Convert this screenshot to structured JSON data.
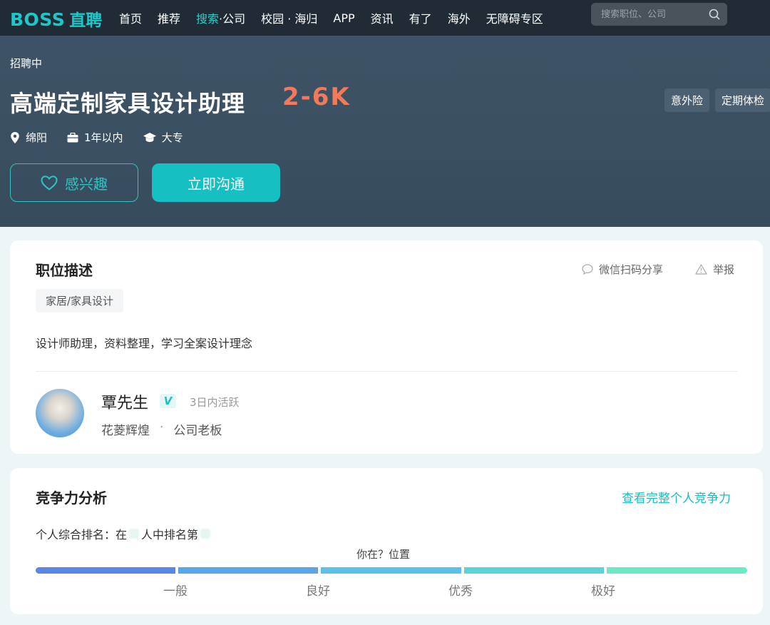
{
  "nav": {
    "logo_text": "BOSS",
    "logo_sub": "直聘",
    "items": [
      "首页",
      "推荐",
      "搜索",
      "·公司",
      "校园 · 海归",
      "APP",
      "资讯",
      "有了",
      "海外",
      "无障碍专区"
    ],
    "search_placeholder": "搜索职位、公司"
  },
  "job": {
    "status": "招聘中",
    "title": "高端定制家具设计助理",
    "salary": "2-6K",
    "location": "绵阳",
    "experience": "1年以内",
    "education": "大专",
    "benefits": [
      "意外险",
      "定期体检"
    ],
    "like_label": "感兴趣",
    "chat_label": "立即沟通"
  },
  "description": {
    "heading": "职位描述",
    "share_label": "微信扫码分享",
    "report_label": "举报",
    "tag": "家居/家具设计",
    "text": "设计师助理，资料整理，学习全案设计理念"
  },
  "recruiter": {
    "name": "覃先生",
    "verified_badge": "V",
    "active": "3日内活跃",
    "company": "花菱辉煌",
    "separator": "·",
    "role": "公司老板"
  },
  "competition": {
    "heading": "竞争力分析",
    "link": "查看完整个人竞争力",
    "rank_prefix": "个人综合排名：在",
    "rank_middle": "人中排名第",
    "position_label": "你在？位置",
    "levels": [
      "一般",
      "良好",
      "优秀",
      "极好"
    ]
  },
  "colors": {
    "accent": "#1ec8c8",
    "salary": "#f2795a",
    "nav_bg": "#202b35",
    "banner_bg": "#3d5266"
  }
}
